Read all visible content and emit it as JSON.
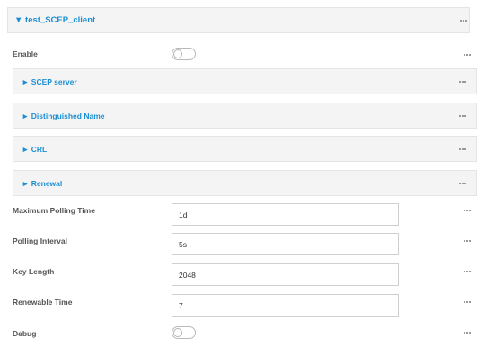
{
  "header": {
    "title": "▼ test_SCEP_client"
  },
  "enable": {
    "label": "Enable"
  },
  "sections": {
    "scep_server": "► SCEP server",
    "distinguished_name": "► Distinguished Name",
    "crl": "► CRL",
    "renewal": "► Renewal"
  },
  "fields": {
    "max_polling_time": {
      "label": "Maximum Polling Time",
      "value": "1d"
    },
    "polling_interval": {
      "label": "Polling Interval",
      "value": "5s"
    },
    "key_length": {
      "label": "Key Length",
      "value": "2048"
    },
    "renewable_time": {
      "label": "Renewable Time",
      "value": "7"
    }
  },
  "debug": {
    "label": "Debug"
  },
  "icons": {
    "more": "more-options-icon"
  },
  "colors": {
    "accent": "#1c8fd4",
    "panel_bg": "#f4f4f4",
    "label": "#555555"
  }
}
